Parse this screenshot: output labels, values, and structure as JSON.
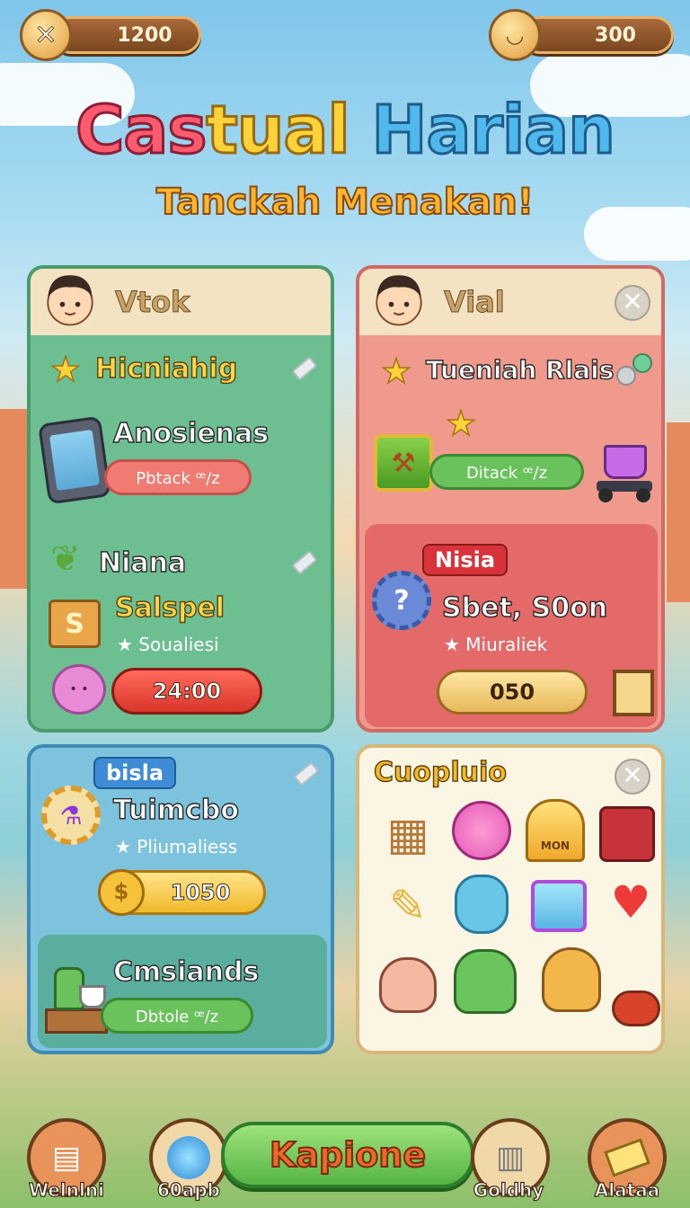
{
  "resources": {
    "left_value": "1200",
    "right_value": "300"
  },
  "header": {
    "title_part1": "Cas",
    "title_part2": "tual",
    "title_part3": "Harian",
    "subtitle": "Tanckah Menakan!"
  },
  "panels": {
    "green": {
      "name": "Vtok",
      "section1_title": "Hicniahig",
      "item1_title": "Anosienas",
      "item1_button": "Pbtack ꟹ/z",
      "section2_title": "Niana",
      "item2_title": "Salspel",
      "item2_sub": "Soualiesi",
      "item2_timer": "24:00"
    },
    "red": {
      "name": "Vial",
      "section1_title": "Tueniah Rlais",
      "item1_button": "Ditack ꟹ/z",
      "tag": "Nisia",
      "item2_title": "Sbet, S0on",
      "item2_sub": "Miuraliek",
      "item2_value": "050"
    },
    "blue": {
      "tag": "bisla",
      "item1_title": "Tuimcbo",
      "item1_sub": "Pliumaliess",
      "item1_value": "1050",
      "item2_title": "Cmsiands",
      "item2_button": "Dbtole ꟹ/z"
    },
    "cream": {
      "title": "Cuopluio",
      "bell_label": "MON",
      "items": [
        "box-icon",
        "flower-icon",
        "bell-icon",
        "gift-icon",
        "feather-icon",
        "bear-icon",
        "clipboard-icon",
        "heart-icon",
        "squirrel-icon",
        "dino-icon",
        "dog-icon",
        "log-icon"
      ]
    }
  },
  "bottom_nav": {
    "btn1": "Welnlni",
    "btn2": "60apb",
    "cta": "Kapione",
    "btn3": "Goldhy",
    "btn4": "Alataa"
  },
  "colors": {
    "green_panel": "#6dbf92",
    "red_panel": "#f09a8e",
    "blue_panel": "#7ec3de",
    "cream_panel": "#fbf5e4"
  }
}
